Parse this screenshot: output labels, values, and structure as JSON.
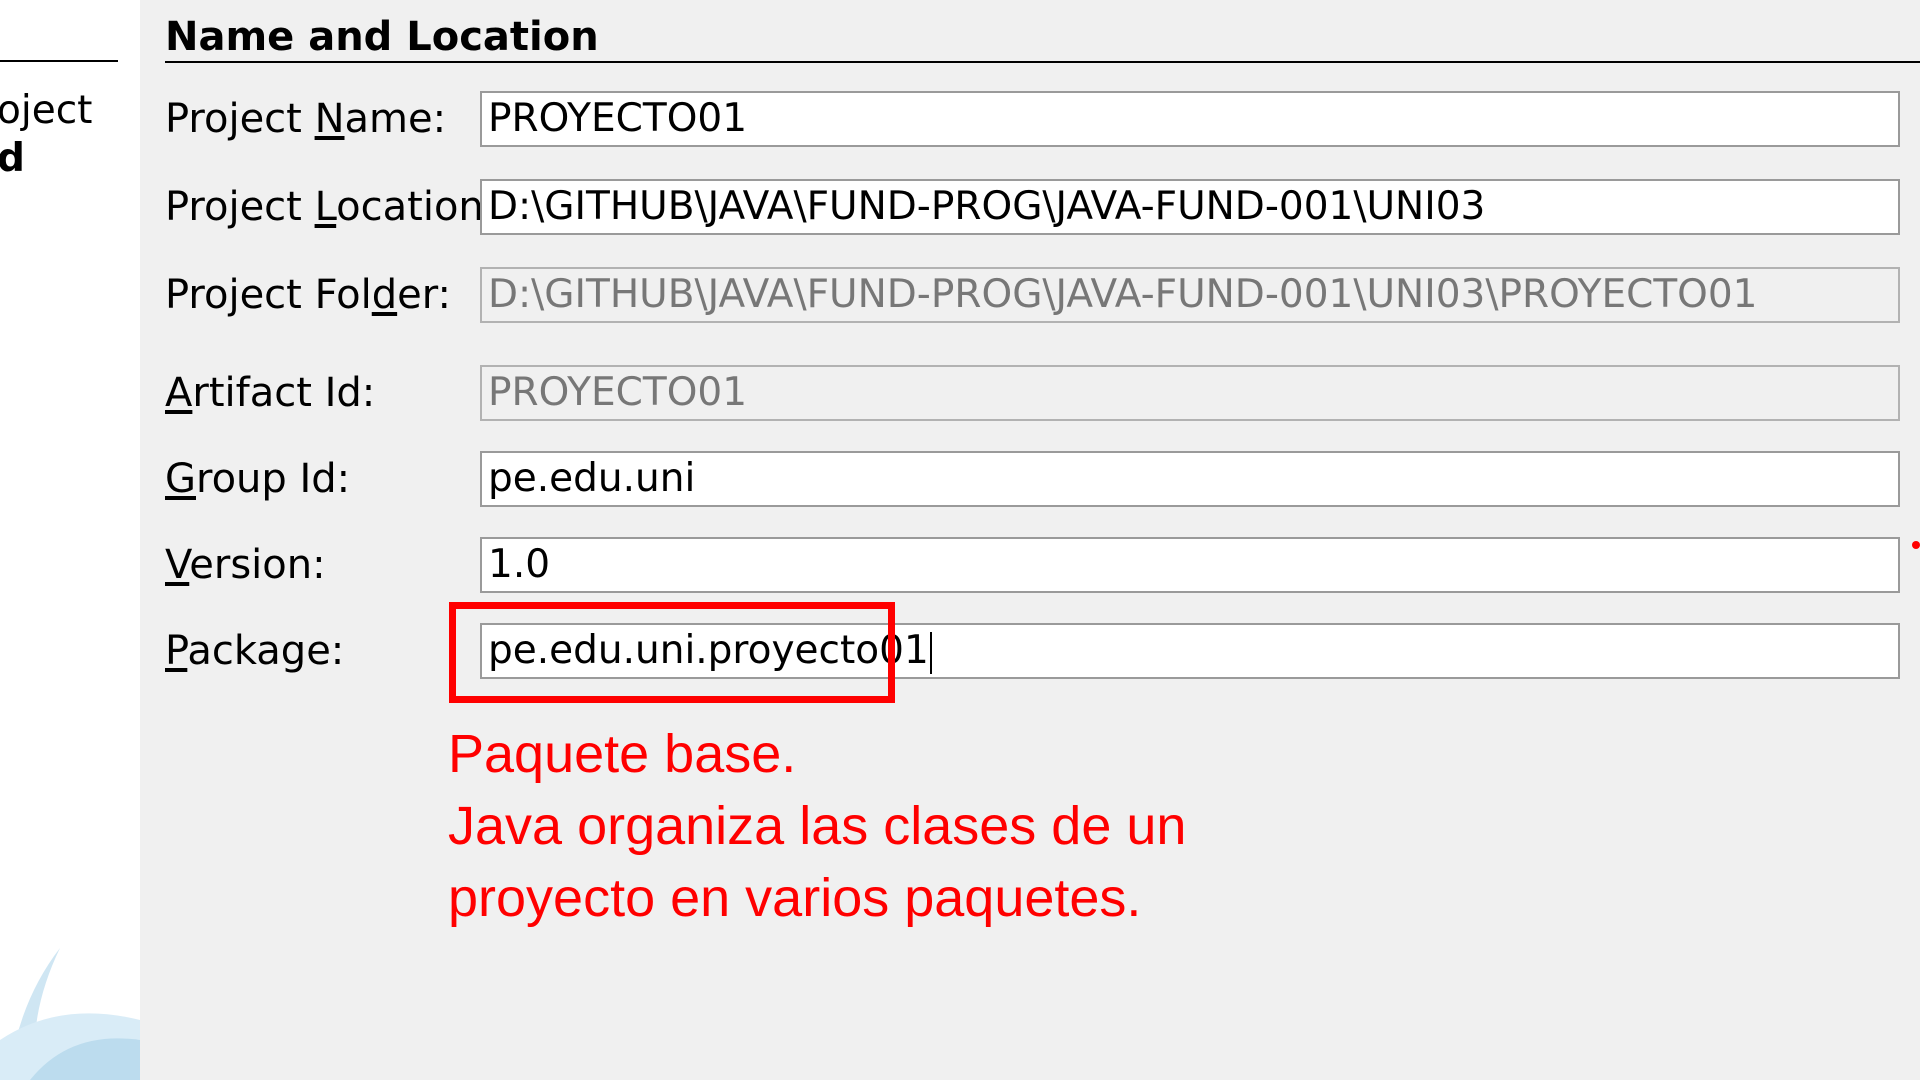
{
  "sidebar": {
    "steps": [
      {
        "text": "oject",
        "current": false
      },
      {
        "text": "d",
        "current": true
      }
    ]
  },
  "section": {
    "title": "Name and Location"
  },
  "form": {
    "project_name": {
      "label_pre": "Project ",
      "label_mnemonic": "N",
      "label_post": "ame:",
      "value": "PROYECTO01"
    },
    "project_location": {
      "label_pre": "Project ",
      "label_mnemonic": "L",
      "label_post": "ocation:",
      "value": "D:\\GITHUB\\JAVA\\FUND-PROG\\JAVA-FUND-001\\UNI03"
    },
    "project_folder": {
      "label_pre": "Project Fol",
      "label_mnemonic": "d",
      "label_post": "er:",
      "value": "D:\\GITHUB\\JAVA\\FUND-PROG\\JAVA-FUND-001\\UNI03\\PROYECTO01"
    },
    "artifact_id": {
      "label_pre": "",
      "label_mnemonic": "A",
      "label_post": "rtifact Id:",
      "value": "PROYECTO01"
    },
    "group_id": {
      "label_pre": "",
      "label_mnemonic": "G",
      "label_post": "roup Id:",
      "value": "pe.edu.uni"
    },
    "version": {
      "label_pre": "",
      "label_mnemonic": "V",
      "label_post": "ersion:",
      "value": "1.0"
    },
    "package": {
      "label_pre": "",
      "label_mnemonic": "P",
      "label_post": "ackage:",
      "value": "pe.edu.uni.proyecto01"
    }
  },
  "annotation": {
    "lines": [
      "Paquete base.",
      "Java organiza las clases de un",
      "proyecto en varios paquetes."
    ],
    "color": "#ff0000"
  }
}
